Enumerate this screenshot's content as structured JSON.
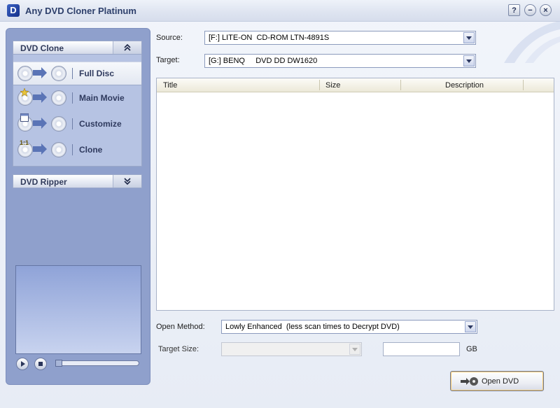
{
  "window": {
    "title": "Any DVD Cloner Platinum",
    "logo_char": "D"
  },
  "titlebar_buttons": {
    "help": "?",
    "minimize": "−",
    "close": "×"
  },
  "sidebar": {
    "dvd_clone": {
      "label": "DVD Clone",
      "toggle": "⌃",
      "expanded": true,
      "options": [
        {
          "label": "Full Disc",
          "selected": true,
          "icon": "full-disc-icon"
        },
        {
          "label": "Main Movie",
          "selected": false,
          "icon": "main-movie-icon"
        },
        {
          "label": "Customize",
          "selected": false,
          "icon": "customize-icon"
        },
        {
          "label": "Clone",
          "selected": false,
          "icon": "clone-icon",
          "badge": "1:1"
        }
      ]
    },
    "dvd_ripper": {
      "label": "DVD Ripper",
      "toggle": "⌄",
      "expanded": false
    }
  },
  "source": {
    "label": "Source:",
    "value": "[F:] LITE-ON  CD-ROM LTN-4891S"
  },
  "target": {
    "label": "Target:",
    "value": "[G:] BENQ     DVD DD DW1620"
  },
  "table": {
    "columns": [
      "Title",
      "Size",
      "Description"
    ],
    "rows": []
  },
  "open_method": {
    "label": "Open Method:",
    "value": "Lowly Enhanced  (less scan times to Decrypt DVD)"
  },
  "target_size": {
    "label": "Target Size:",
    "value": "",
    "unit": "GB",
    "size_value": ""
  },
  "player": {
    "progress": 0
  },
  "open_dvd_button": {
    "label": "Open DVD"
  },
  "colors": {
    "panel": "#8fa0cc",
    "accent": "#5a74b6",
    "title_text": "#2d3f6b"
  }
}
